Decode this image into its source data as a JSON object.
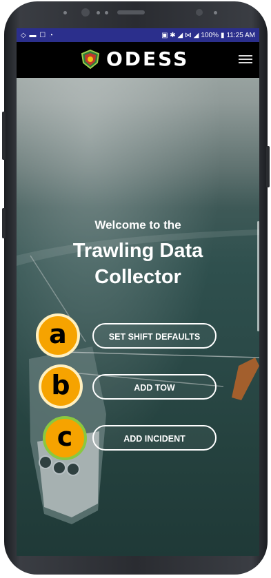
{
  "status_bar": {
    "battery": "100%",
    "time": "11:25 AM"
  },
  "brand": {
    "name": "ODESS"
  },
  "hero": {
    "welcome": "Welcome to the",
    "title_line1": "Trawling Data",
    "title_line2": "Collector"
  },
  "actions": [
    {
      "label": "SET SHIFT DEFAULTS",
      "badge": "a"
    },
    {
      "label": "ADD TOW",
      "badge": "b"
    },
    {
      "label": "ADD INCIDENT",
      "badge": "c"
    }
  ],
  "colors": {
    "status_bar": "#2b2f8c",
    "nav_bar": "#000000",
    "badge_fill": "#f6a300",
    "badge_ring_c": "#8ac840"
  }
}
